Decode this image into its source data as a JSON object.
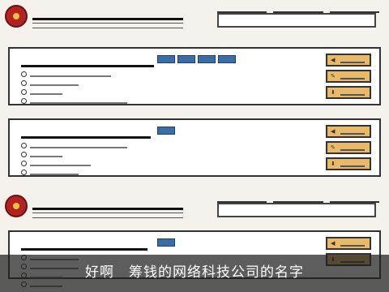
{
  "header": {
    "title": "",
    "subtitle": "",
    "nav_tabs": [
      "",
      "",
      ""
    ],
    "search_placeholder": ""
  },
  "cards": [
    {
      "company_name": "",
      "info_rows": [
        "",
        "",
        "",
        ""
      ],
      "actions": [
        "",
        "",
        ""
      ]
    },
    {
      "company_name": "",
      "info_rows": [
        "",
        "",
        "",
        ""
      ],
      "actions": [
        "",
        "",
        ""
      ]
    },
    {
      "company_name": "",
      "info_rows": [
        "",
        "",
        "",
        ""
      ],
      "actions": [
        "",
        ""
      ]
    }
  ],
  "caption": "好啊　筹钱的网络科技公司的名字",
  "colors": {
    "background": "#f5f2ee",
    "card_border": "#333333",
    "badge_blue": "#3a6ea5",
    "action_orange": "#e8b96a",
    "seal_red": "#b22222"
  },
  "icons": [
    "national-emblem-icon",
    "search-icon",
    "share-icon",
    "edit-icon",
    "download-icon"
  ]
}
